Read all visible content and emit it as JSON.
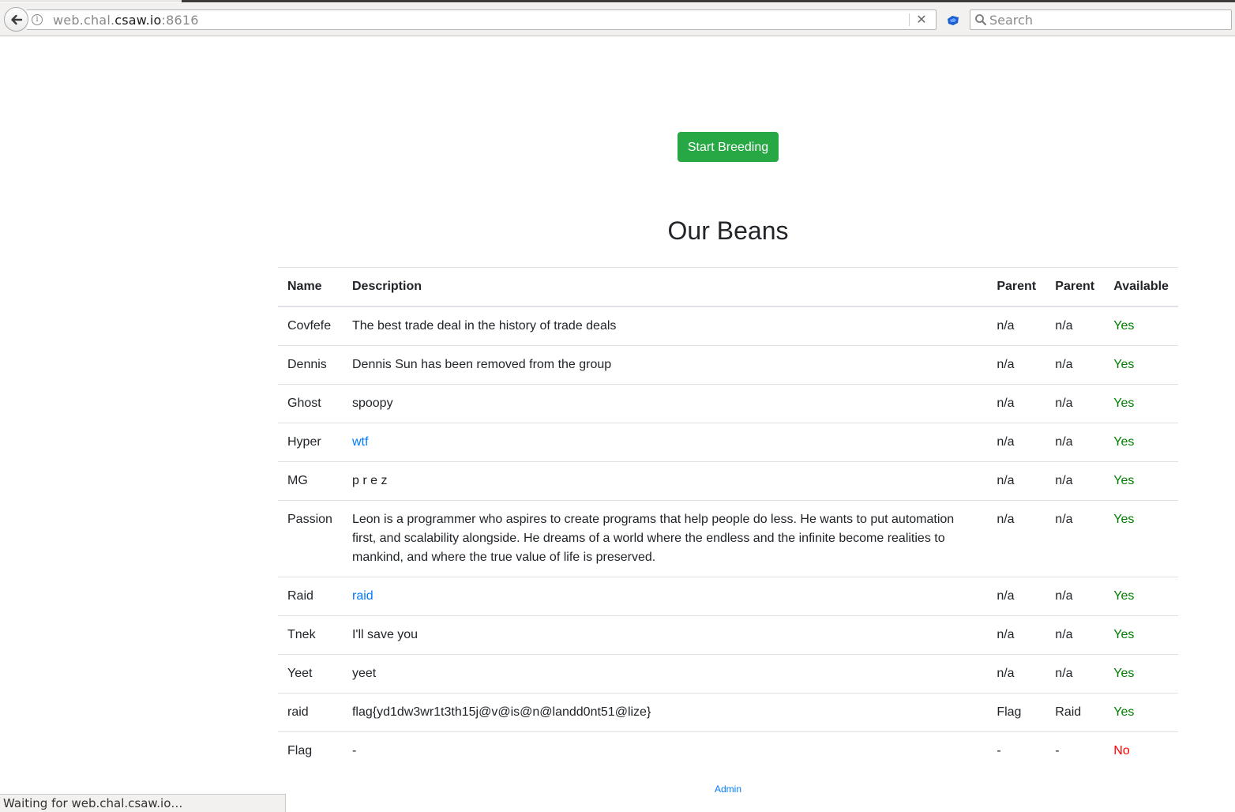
{
  "browser": {
    "url_host_prefix": "web.chal.",
    "url_host_domain": "csaw.io",
    "url_port": ":8616",
    "search_placeholder": "Search",
    "stop_glyph": "✕",
    "icons": {
      "back": "back-arrow-icon",
      "info": "info-icon",
      "stop": "close-icon",
      "extension": "extension-icon",
      "search": "search-icon"
    },
    "status_text": "Waiting for web.chal.csaw.io…"
  },
  "page": {
    "breed_button_label": "Start Breeding",
    "title": "Our Beans",
    "admin_link_label": "Admin",
    "colors": {
      "button": "#28a745",
      "link": "#007bff",
      "yes": "#008000",
      "no": "#ff0000"
    }
  },
  "table": {
    "headers": [
      "Name",
      "Description",
      "Parent",
      "Parent",
      "Available"
    ],
    "rows": [
      {
        "name": "Covfefe",
        "description": "The best trade deal in the history of trade deals",
        "description_is_link": false,
        "parent1": "n/a",
        "parent2": "n/a",
        "available": "Yes"
      },
      {
        "name": "Dennis",
        "description": "Dennis Sun has been removed from the group",
        "description_is_link": false,
        "parent1": "n/a",
        "parent2": "n/a",
        "available": "Yes"
      },
      {
        "name": "Ghost",
        "description": "spoopy",
        "description_is_link": false,
        "parent1": "n/a",
        "parent2": "n/a",
        "available": "Yes"
      },
      {
        "name": "Hyper",
        "description": "wtf",
        "description_is_link": true,
        "parent1": "n/a",
        "parent2": "n/a",
        "available": "Yes"
      },
      {
        "name": "MG",
        "description": "p r e z",
        "description_is_link": false,
        "parent1": "n/a",
        "parent2": "n/a",
        "available": "Yes"
      },
      {
        "name": "Passion",
        "description": "Leon is a programmer who aspires to create programs that help people do less. He wants to put automation first, and scalability alongside. He dreams of a world where the endless and the infinite become realities to mankind, and where the true value of life is preserved.",
        "description_is_link": false,
        "parent1": "n/a",
        "parent2": "n/a",
        "available": "Yes"
      },
      {
        "name": "Raid",
        "description": "raid",
        "description_is_link": true,
        "parent1": "n/a",
        "parent2": "n/a",
        "available": "Yes"
      },
      {
        "name": "Tnek",
        "description": "I'll save you",
        "description_is_link": false,
        "parent1": "n/a",
        "parent2": "n/a",
        "available": "Yes"
      },
      {
        "name": "Yeet",
        "description": "yeet",
        "description_is_link": false,
        "parent1": "n/a",
        "parent2": "n/a",
        "available": "Yes"
      },
      {
        "name": "raid",
        "description": "flag{yd1dw3wr1t3th15j@v@is@n@landd0nt51@lize}",
        "description_is_link": false,
        "parent1": "Flag",
        "parent2": "Raid",
        "available": "Yes"
      },
      {
        "name": "Flag",
        "description": "-",
        "description_is_link": false,
        "parent1": "-",
        "parent2": "-",
        "available": "No"
      }
    ]
  }
}
